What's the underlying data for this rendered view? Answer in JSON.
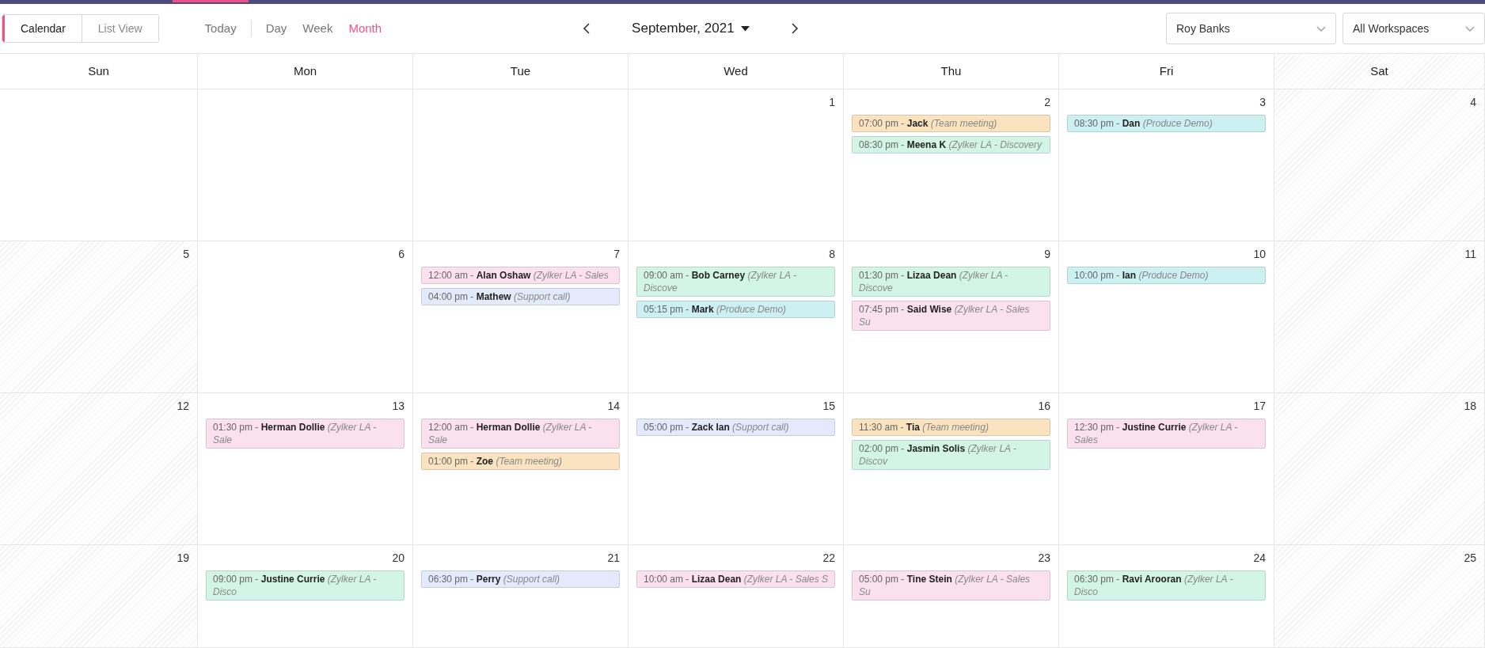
{
  "view_toggle": [
    {
      "label": "Calendar",
      "selected": true
    },
    {
      "label": "List View",
      "selected": false
    }
  ],
  "today_button": "Today",
  "ranges": [
    {
      "label": "Day",
      "selected": false
    },
    {
      "label": "Week",
      "selected": false
    },
    {
      "label": "Month",
      "selected": true
    }
  ],
  "month_picker": {
    "label": "September, 2021"
  },
  "user_select": {
    "value": "Roy Banks"
  },
  "workspace_select": {
    "value": "All Workspaces"
  },
  "weekdays": [
    {
      "label": "Sun",
      "hatched": false
    },
    {
      "label": "Mon",
      "hatched": false
    },
    {
      "label": "Tue",
      "hatched": false
    },
    {
      "label": "Wed",
      "hatched": false
    },
    {
      "label": "Thu",
      "hatched": false
    },
    {
      "label": "Fri",
      "hatched": false
    },
    {
      "label": "Sat",
      "hatched": true
    }
  ],
  "weeks": [
    [
      {
        "hatched": false
      },
      {
        "hatched": false
      },
      {
        "hatched": false
      },
      {
        "day": "1",
        "hatched": false
      },
      {
        "day": "2",
        "hatched": false,
        "events": [
          {
            "text": "07:00 pm - **Jack** *(Team meeting)*",
            "color": "#fbe3c0"
          },
          {
            "text": "08:30 pm - **Meena K** *(Zylker LA - Discovery*",
            "color": "#d3f5e7"
          }
        ]
      },
      {
        "day": "3",
        "hatched": false,
        "events": [
          {
            "text": "08:30 pm - **Dan** *(Produce Demo)*",
            "color": "#cdf0f2"
          }
        ]
      },
      {
        "day": "4",
        "hatched": true
      }
    ],
    [
      {
        "day": "5",
        "hatched": true
      },
      {
        "day": "6",
        "hatched": false
      },
      {
        "day": "7",
        "hatched": false,
        "events": [
          {
            "text": "12:00 am - **Alan Oshaw** *(Zylker LA - Sales*",
            "color": "#fbe0ee"
          },
          {
            "text": "04:00 pm - **Mathew** *(Support call)*",
            "color": "#e3eafb"
          }
        ]
      },
      {
        "day": "8",
        "hatched": false,
        "events": [
          {
            "text": "09:00 am - **Bob Carney** *(Zylker LA - Discove*",
            "color": "#d3f5e7"
          },
          {
            "text": "05:15 pm - **Mark** *(Produce Demo)*",
            "color": "#cdf0f2"
          }
        ]
      },
      {
        "day": "9",
        "hatched": false,
        "events": [
          {
            "text": "01:30 pm - **Lizaa Dean** *(Zylker LA - Discove*",
            "color": "#d3f5e7"
          },
          {
            "text": "07:45 pm - **Said Wise** *(Zylker LA - Sales Su*",
            "color": "#fbe0ee"
          }
        ]
      },
      {
        "day": "10",
        "hatched": false,
        "events": [
          {
            "text": "10:00 pm - **Ian** *(Produce Demo)*",
            "color": "#cdf0f2"
          }
        ]
      },
      {
        "day": "11",
        "hatched": true
      }
    ],
    [
      {
        "day": "12",
        "hatched": true
      },
      {
        "day": "13",
        "hatched": false,
        "events": [
          {
            "text": "01:30 pm - **Herman Dollie** *(Zylker LA - Sale*",
            "color": "#fbe0ee"
          }
        ]
      },
      {
        "day": "14",
        "hatched": false,
        "events": [
          {
            "text": "12:00 am - **Herman Dollie** *(Zylker LA - Sale*",
            "color": "#fbe0ee"
          },
          {
            "text": "01:00 pm - **Zoe** *(Team meeting)*",
            "color": "#fbe3c0"
          }
        ]
      },
      {
        "day": "15",
        "hatched": false,
        "events": [
          {
            "text": "05:00 pm - **Zack Ian** *(Support call)*",
            "color": "#e3eafb"
          }
        ]
      },
      {
        "day": "16",
        "hatched": false,
        "events": [
          {
            "text": "11:30 am - **Tia** *(Team meeting)*",
            "color": "#fbe3c0"
          },
          {
            "text": "02:00 pm - **Jasmin Solis** *(Zylker LA - Discov*",
            "color": "#d3f5e7"
          }
        ]
      },
      {
        "day": "17",
        "hatched": false,
        "events": [
          {
            "text": "12:30 pm - **Justine Currie** *(Zylker LA - Sales*",
            "color": "#fbe0ee"
          }
        ]
      },
      {
        "day": "18",
        "hatched": true
      }
    ],
    [
      {
        "day": "19",
        "hatched": true
      },
      {
        "day": "20",
        "hatched": false,
        "events": [
          {
            "text": "09:00 pm - **Justine Currie** *(Zylker LA - Disco*",
            "color": "#d3f5e7"
          }
        ]
      },
      {
        "day": "21",
        "hatched": false,
        "events": [
          {
            "text": "06:30 pm - **Perry** *(Support call)*",
            "color": "#e3eafb"
          }
        ]
      },
      {
        "day": "22",
        "hatched": false,
        "events": [
          {
            "text": "10:00 am - **Lizaa Dean** *(Zylker LA - Sales S*",
            "color": "#fbe0ee"
          }
        ]
      },
      {
        "day": "23",
        "hatched": false,
        "events": [
          {
            "text": "05:00 pm - **Tine Stein** *(Zylker LA - Sales Su*",
            "color": "#fbe0ee"
          }
        ]
      },
      {
        "day": "24",
        "hatched": false,
        "events": [
          {
            "text": "06:30 pm - **Ravi Arooran** *(Zylker LA - Disco*",
            "color": "#d3f5e7"
          }
        ]
      },
      {
        "day": "25",
        "hatched": true
      }
    ]
  ]
}
